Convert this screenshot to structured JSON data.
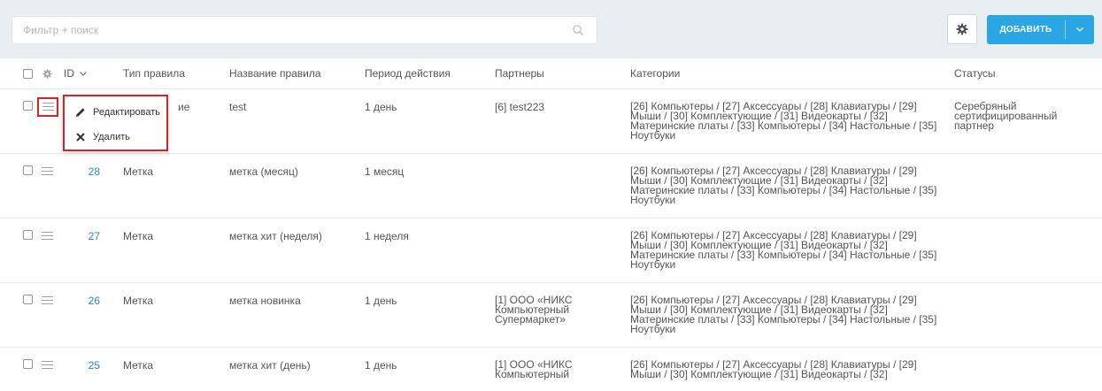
{
  "search": {
    "placeholder": "Фильтр + поиск",
    "value": ""
  },
  "toolbar": {
    "add_label": "ДОБАВИТЬ"
  },
  "colors": {
    "accent": "#2aa6e4",
    "highlight": "#d6232a",
    "link": "#2a87c5"
  },
  "table": {
    "headers": {
      "id": "ID",
      "type": "Тип правила",
      "name": "Название правила",
      "period": "Период действия",
      "partners": "Партнеры",
      "categories": "Категории",
      "statuses": "Статусы"
    },
    "rows": [
      {
        "id": "",
        "type_fragment": "ие",
        "name": "test",
        "period": "1 день",
        "partners": [
          "[6] test223"
        ],
        "categories": [
          "[26] Компьютеры / [27] Аксессуары / [28] Клавиатуры / [29]",
          "Мыши / [30] Комплектующие / [31] Видеокарты / [32]",
          "Материнские платы / [33] Компьютеры / [34] Настольные / [35]",
          "Ноутбуки"
        ],
        "statuses": [
          "Серебряный",
          "сертифицированный",
          "партнер"
        ]
      },
      {
        "id": "28",
        "type": "Метка",
        "name": "метка (месяц)",
        "period": "1 месяц",
        "partners": [],
        "categories": [
          "[26] Компьютеры / [27] Аксессуары / [28] Клавиатуры / [29]",
          "Мыши / [30] Комплектующие / [31] Видеокарты / [32]",
          "Материнские платы / [33] Компьютеры / [34] Настольные / [35]",
          "Ноутбуки"
        ],
        "statuses": []
      },
      {
        "id": "27",
        "type": "Метка",
        "name": "метка хит (неделя)",
        "period": "1 неделя",
        "partners": [],
        "categories": [
          "[26] Компьютеры / [27] Аксессуары / [28] Клавиатуры / [29]",
          "Мыши / [30] Комплектующие / [31] Видеокарты / [32]",
          "Материнские платы / [33] Компьютеры / [34] Настольные / [35]",
          "Ноутбуки"
        ],
        "statuses": []
      },
      {
        "id": "26",
        "type": "Метка",
        "name": "метка новинка",
        "period": "1 день",
        "partners": [
          "[1] ООО «НИКС",
          "Компьютерный",
          "Супермаркет»"
        ],
        "categories": [
          "[26] Компьютеры / [27] Аксессуары / [28] Клавиатуры / [29]",
          "Мыши / [30] Комплектующие / [31] Видеокарты / [32]",
          "Материнские платы / [33] Компьютеры / [34] Настольные / [35]",
          "Ноутбуки"
        ],
        "statuses": []
      },
      {
        "id": "25",
        "type": "Метка",
        "name": "метка хит (день)",
        "period": "1 день",
        "partners": [
          "[1] ООО «НИКС",
          "Компьютерный"
        ],
        "categories": [
          "[26] Компьютеры / [27] Аксессуары / [28] Клавиатуры / [29]",
          "Мыши / [30] Комплектующие / [31] Видеокарты / [32]"
        ],
        "statuses": []
      }
    ]
  },
  "context_menu": {
    "edit_label": "Редактировать",
    "delete_label": "Удалить"
  }
}
